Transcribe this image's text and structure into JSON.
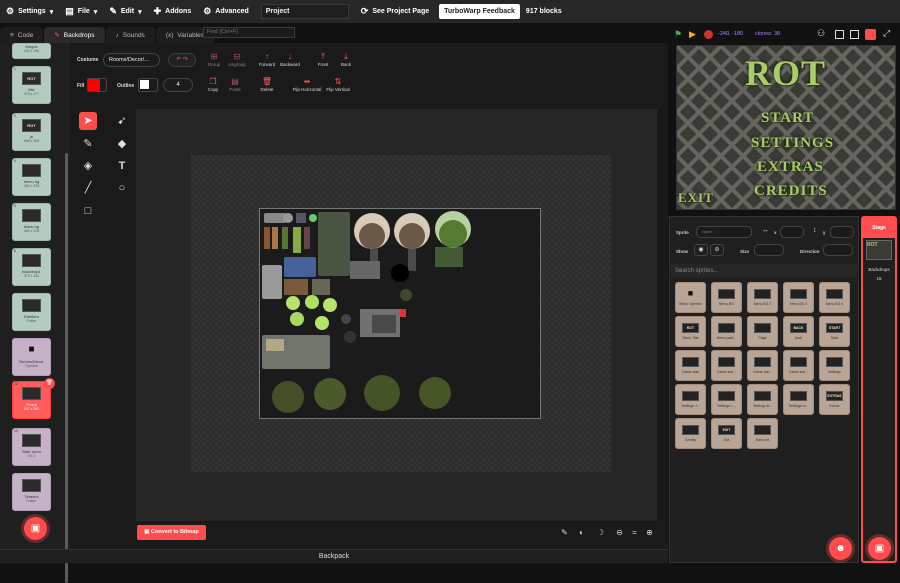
{
  "menu": {
    "settings": "Settings",
    "file": "File",
    "edit": "Edit",
    "addons": "Addons",
    "advanced": "Advanced",
    "project_title": "Project",
    "see_project_page": "See Project Page",
    "feedback": "TurboWarp Feedback",
    "blocks": "917 blocks"
  },
  "tabs": {
    "code": "Code",
    "backdrops": "Backdrops",
    "sounds": "Sounds",
    "variables": "Variables"
  },
  "find_placeholder": "Find (Ctrl+F)",
  "costume_list": [
    {
      "num": "",
      "name": "fungus",
      "size": "254 x 196",
      "thumb": "",
      "folder": false
    },
    {
      "num": "1",
      "name": "title",
      "size": "479 x 277",
      "thumb": "ROT",
      "folder": false
    },
    {
      "num": "2",
      "name": "jn",
      "size": "808 x 308",
      "thumb": "ROT",
      "folder": false
    },
    {
      "num": "4",
      "name": "menu bg",
      "size": "482 x 378",
      "thumb": "",
      "folder": false
    },
    {
      "num": "5",
      "name": "black bg",
      "size": "482 x 378",
      "thumb": "",
      "folder": false
    },
    {
      "num": "6",
      "name": "backdrop1",
      "size": "372 x 102",
      "thumb": "",
      "folder": false
    },
    {
      "num": "",
      "name": "Emblem",
      "size": "Folder",
      "thumb": "",
      "folder": false
    },
    {
      "num": "",
      "name": "Rooms/Decor",
      "size": "Opened",
      "thumb": "",
      "folder": true
    },
    {
      "num": "12",
      "name": "Props",
      "size": "567 x 389",
      "thumb": "",
      "folder": false,
      "selected": true
    },
    {
      "num": "13",
      "name": "Start room",
      "size": "3 x 2",
      "thumb": "",
      "folder": true
    },
    {
      "num": "",
      "name": "Teasers",
      "size": "Folder",
      "thumb": "",
      "folder": true
    }
  ],
  "paint": {
    "costume_label": "Costume",
    "costume_name": "Rooms/Decor/...",
    "fill_label": "Fill",
    "outline_label": "Outline",
    "outline_width": "4",
    "fill_color": "#ff0000",
    "outline_color": "#ffffff",
    "group": "Group",
    "ungroup": "Ungroup",
    "forward": "Forward",
    "backward": "Backward",
    "front": "Front",
    "back": "Back",
    "copy": "Copy",
    "paste": "Paste",
    "delete": "Delete",
    "flip_h": "Flip Horizontal",
    "flip_v": "Flip Vertical",
    "convert": "Convert to Bitmap"
  },
  "backpack": "Backpack",
  "stage_header": {
    "coords": "-240, -180",
    "clones": "clones: 38"
  },
  "stage_preview": {
    "title": "ROT",
    "start": "START",
    "settings": "SETTINGS",
    "extras": "EXTRAS",
    "credits": "CREDITS",
    "exit": "EXIT"
  },
  "sprite_info": {
    "sprite_label": "Sprite",
    "name_placeholder": "Name",
    "x_label": "x",
    "y_label": "y",
    "show_label": "Show",
    "size_label": "Size",
    "direction_label": "Direction",
    "search_placeholder": "Search sprites..."
  },
  "sprites": [
    {
      "name": "Menu Opened",
      "thumb": ""
    },
    {
      "name": "Menu BG",
      "thumb": ""
    },
    {
      "name": "Menu BG 2",
      "thumb": ""
    },
    {
      "name": "Menu BG 3",
      "thumb": ""
    },
    {
      "name": "Menu BG 4",
      "thumb": ""
    },
    {
      "name": "Menu Title",
      "thumb": "ROT"
    },
    {
      "name": "Menu parti...",
      "thumb": ""
    },
    {
      "name": "Page",
      "thumb": ""
    },
    {
      "name": "back",
      "thumb": "BACK"
    },
    {
      "name": "Start",
      "thumb": "START"
    },
    {
      "name": "Game start",
      "thumb": ""
    },
    {
      "name": "Game star...",
      "thumb": ""
    },
    {
      "name": "Game star...",
      "thumb": ""
    },
    {
      "name": "Game star...",
      "thumb": ""
    },
    {
      "name": "Settings",
      "thumb": ""
    },
    {
      "name": "Settings J...",
      "thumb": ""
    },
    {
      "name": "Settings L...",
      "thumb": ""
    },
    {
      "name": "Settings B...",
      "thumb": ""
    },
    {
      "name": "Settings re...",
      "thumb": ""
    },
    {
      "name": "Extras",
      "thumb": "EXTRAS"
    },
    {
      "name": "Credits",
      "thumb": ""
    },
    {
      "name": "Exit",
      "thumb": "EXIT"
    },
    {
      "name": "Menu txt",
      "thumb": ""
    }
  ],
  "stage_selector": {
    "title": "Stage",
    "backdrops_label": "Backdrops",
    "backdrops_count": "15"
  },
  "colors": {
    "accent": "#ff4c4c",
    "costume_tile": "#b4ccbe",
    "folder_tile": "#c7b1c9",
    "sprite_tile": "#b9a596",
    "stage_text": "#a9cc6a"
  }
}
